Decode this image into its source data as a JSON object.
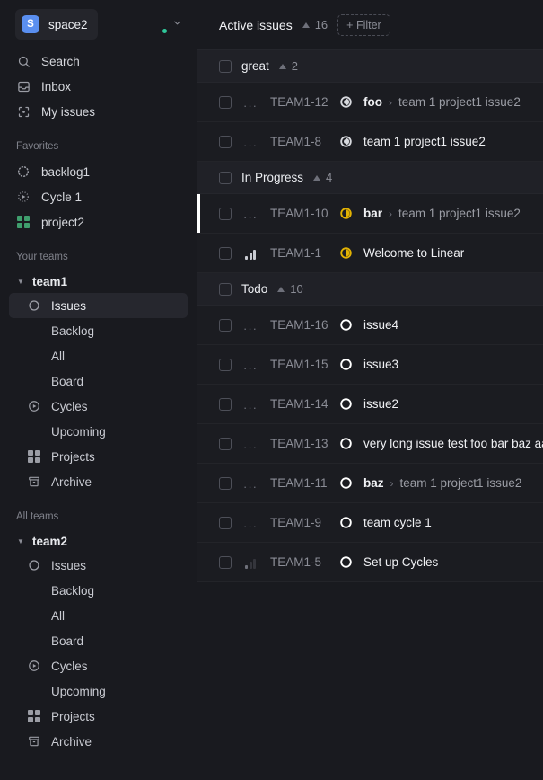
{
  "workspace": {
    "badge_letter": "S",
    "name": "space2",
    "badge_color": "#5a8ff0",
    "avatar_presence_color": "#2fc79a",
    "chevron": "⌄"
  },
  "sidebar": {
    "primary": [
      {
        "label": "Search",
        "icon": "search-icon"
      },
      {
        "label": "Inbox",
        "icon": "inbox-icon"
      },
      {
        "label": "My issues",
        "icon": "my-issues-icon"
      }
    ],
    "favorites_title": "Favorites",
    "favorites": [
      {
        "label": "backlog1",
        "icon": "backlog-dotted-circle-icon"
      },
      {
        "label": "Cycle 1",
        "icon": "cycle-play-icon"
      },
      {
        "label": "project2",
        "icon": "project-grid-icon"
      }
    ],
    "your_teams_title": "Your teams",
    "all_teams_title": "All teams",
    "teams": [
      {
        "name": "team1",
        "items": [
          {
            "label": "Issues",
            "icon": "issue-circle-icon",
            "selected": true
          },
          {
            "label": "Backlog",
            "icon": "none",
            "selected": false
          },
          {
            "label": "All",
            "icon": "none",
            "selected": false
          },
          {
            "label": "Board",
            "icon": "none",
            "selected": false
          },
          {
            "label": "Cycles",
            "icon": "cycle-play-icon",
            "selected": false
          },
          {
            "label": "Upcoming",
            "icon": "none",
            "selected": false
          },
          {
            "label": "Projects",
            "icon": "project-grid-icon",
            "selected": false
          },
          {
            "label": "Archive",
            "icon": "archive-icon",
            "selected": false
          }
        ]
      },
      {
        "name": "team2",
        "items": [
          {
            "label": "Issues",
            "icon": "issue-circle-icon",
            "selected": false
          },
          {
            "label": "Backlog",
            "icon": "none",
            "selected": false
          },
          {
            "label": "All",
            "icon": "none",
            "selected": false
          },
          {
            "label": "Board",
            "icon": "none",
            "selected": false
          },
          {
            "label": "Cycles",
            "icon": "cycle-play-icon",
            "selected": false
          },
          {
            "label": "Upcoming",
            "icon": "none",
            "selected": false
          },
          {
            "label": "Projects",
            "icon": "project-grid-icon",
            "selected": false
          },
          {
            "label": "Archive",
            "icon": "archive-icon",
            "selected": false
          }
        ]
      }
    ]
  },
  "header": {
    "title": "Active issues",
    "count": "16",
    "filter_label": "+ Filter"
  },
  "groups": [
    {
      "label": "great",
      "count": "2",
      "issues": [
        {
          "identifier": "TEAM1-12",
          "priority": "none",
          "status": "done",
          "status_color": "#d7d9de",
          "title": "foo",
          "separator": "›",
          "subtitle": "team 1 project1 issue2",
          "active": false
        },
        {
          "identifier": "TEAM1-8",
          "priority": "none",
          "status": "done",
          "status_color": "#d7d9de",
          "title": "team 1 project1 issue2",
          "separator": "",
          "subtitle": "",
          "active": false
        }
      ]
    },
    {
      "label": "In Progress",
      "count": "4",
      "issues": [
        {
          "identifier": "TEAM1-10",
          "priority": "none",
          "status": "in-progress",
          "status_color": "#e2b203",
          "title": "bar",
          "separator": "›",
          "subtitle": "team 1 project1 issue2",
          "active": true
        },
        {
          "identifier": "TEAM1-1",
          "priority": "high",
          "status": "in-progress",
          "status_color": "#e2b203",
          "title": "Welcome to Linear",
          "separator": "",
          "subtitle": "",
          "active": false
        }
      ]
    },
    {
      "label": "Todo",
      "count": "10",
      "issues": [
        {
          "identifier": "TEAM1-16",
          "priority": "none",
          "status": "todo",
          "status_color": "#ffffff",
          "title": "issue4",
          "separator": "",
          "subtitle": "",
          "active": false
        },
        {
          "identifier": "TEAM1-15",
          "priority": "none",
          "status": "todo",
          "status_color": "#ffffff",
          "title": "issue3",
          "separator": "",
          "subtitle": "",
          "active": false
        },
        {
          "identifier": "TEAM1-14",
          "priority": "none",
          "status": "todo",
          "status_color": "#ffffff",
          "title": "issue2",
          "separator": "",
          "subtitle": "",
          "active": false
        },
        {
          "identifier": "TEAM1-13",
          "priority": "none",
          "status": "todo",
          "status_color": "#ffffff",
          "title": "very long issue test foo bar baz aaa",
          "separator": "",
          "subtitle": "",
          "active": false
        },
        {
          "identifier": "TEAM1-11",
          "priority": "none",
          "status": "todo",
          "status_color": "#ffffff",
          "title": "baz",
          "separator": "›",
          "subtitle": "team 1 project1 issue2",
          "active": false
        },
        {
          "identifier": "TEAM1-9",
          "priority": "none",
          "status": "todo",
          "status_color": "#ffffff",
          "title": "team cycle 1",
          "separator": "",
          "subtitle": "",
          "active": false
        },
        {
          "identifier": "TEAM1-5",
          "priority": "low",
          "status": "todo",
          "status_color": "#ffffff",
          "title": "Set up Cycles",
          "separator": "",
          "subtitle": "",
          "active": false
        }
      ]
    }
  ]
}
